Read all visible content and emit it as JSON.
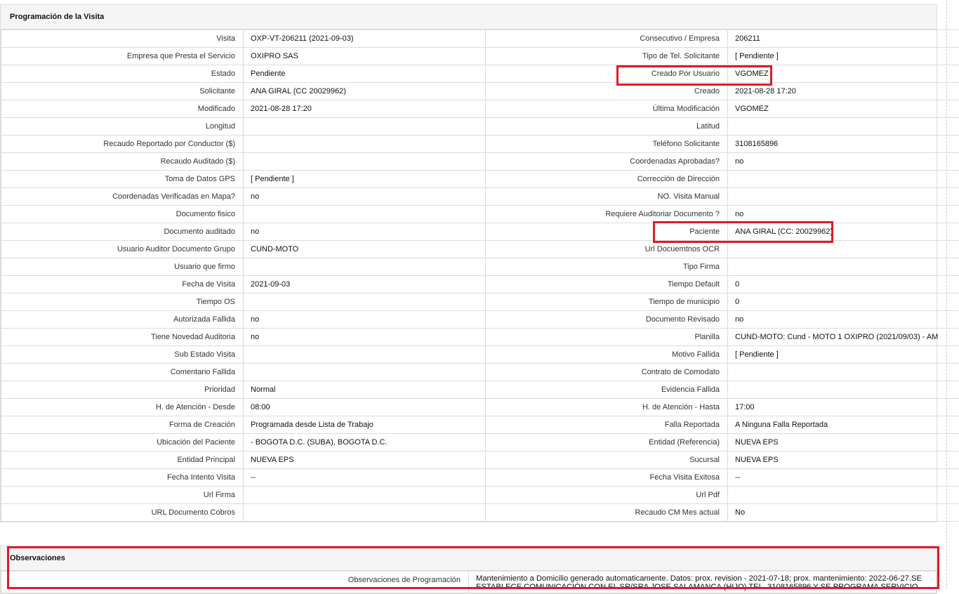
{
  "panel": {
    "title": "Programación de la Visita",
    "rows": [
      [
        {
          "label": "Visita",
          "value": "OXP-VT-206211 (2021-09-03)"
        },
        {
          "label": "Consecutivo / Empresa",
          "value": "206211"
        }
      ],
      [
        {
          "label": "Empresa que Presta el Servicio",
          "value": "OXIPRO SAS"
        },
        {
          "label": "Tipo de Tel. Solicitante",
          "value": "[ Pendiente ]"
        }
      ],
      [
        {
          "label": "Estado",
          "value": "Pendiente"
        },
        {
          "label": "Creado Por Usuario",
          "value": "VGOMEZ"
        }
      ],
      [
        {
          "label": "Solicitante",
          "value": "ANA GIRAL (CC 20029962)"
        },
        {
          "label": "Creado",
          "value": "2021-08-28 17:20"
        }
      ],
      [
        {
          "label": "Modificado",
          "value": "2021-08-28 17:20"
        },
        {
          "label": "Última Modificación",
          "value": " VGOMEZ"
        }
      ],
      [
        {
          "label": "Longitud",
          "value": ""
        },
        {
          "label": "Latitud",
          "value": ""
        }
      ],
      [
        {
          "label": "Recaudo Reportado por Conductor ($)",
          "value": ""
        },
        {
          "label": "Teléfono Solicitante",
          "value": "3108165896"
        }
      ],
      [
        {
          "label": "Recaudo Auditado ($)",
          "value": ""
        },
        {
          "label": "Coordenadas Aprobadas?",
          "value": " no"
        }
      ],
      [
        {
          "label": "Toma de Datos GPS",
          "value": "[ Pendiente ]"
        },
        {
          "label": "Corrección de Dirección",
          "value": ""
        }
      ],
      [
        {
          "label": "Coordenadas Verificadas en Mapa?",
          "value": " no"
        },
        {
          "label": "NO. Visita Manual",
          "value": ""
        }
      ],
      [
        {
          "label": "Documento fisico",
          "value": ""
        },
        {
          "label": "Requiere Auditoriar Documento ?",
          "value": " no"
        }
      ],
      [
        {
          "label": "Documento auditado",
          "value": " no"
        },
        {
          "label": "Paciente",
          "value": "ANA GIRAL (CC: 20029962)"
        }
      ],
      [
        {
          "label": "Usuario Auditor Documento Grupo",
          "value": "CUND-MOTO"
        },
        {
          "label": "Url Docuemtnos OCR",
          "value": ""
        }
      ],
      [
        {
          "label": "Usuario que firmo",
          "value": ""
        },
        {
          "label": "Tipo Firma",
          "value": ""
        }
      ],
      [
        {
          "label": "Fecha de Visita",
          "value": " 2021-09-03"
        },
        {
          "label": "Tiempo Default",
          "value": "0"
        }
      ],
      [
        {
          "label": "Tiempo OS",
          "value": ""
        },
        {
          "label": "Tiempo de municipio",
          "value": "0"
        }
      ],
      [
        {
          "label": "Autorizada Fallida",
          "value": " no"
        },
        {
          "label": "Documento Revisado",
          "value": " no"
        }
      ],
      [
        {
          "label": "Tiene Novedad Auditoria",
          "value": " no"
        },
        {
          "label": "Planilla",
          "value": "CUND-MOTO: Cund - MOTO 1 OXIPRO (2021/09/03) - AM"
        }
      ],
      [
        {
          "label": "Sub Estado Visita",
          "value": ""
        },
        {
          "label": "Motivo Fallida",
          "value": "[ Pendiente ]"
        }
      ],
      [
        {
          "label": "Comentario Fallida",
          "value": ""
        },
        {
          "label": "Contrato de Comodato",
          "value": ""
        }
      ],
      [
        {
          "label": "Prioridad",
          "value": "Normal"
        },
        {
          "label": "Evidencia Fallida",
          "value": ""
        }
      ],
      [
        {
          "label": "H. de Atención - Desde",
          "value": "08:00"
        },
        {
          "label": "H. de Atención - Hasta",
          "value": "17:00"
        }
      ],
      [
        {
          "label": "Forma de Creación",
          "value": "Programada desde Lista de Trabajo"
        },
        {
          "label": "Falla Reportada",
          "value": "A Ninguna Falla Reportada"
        }
      ],
      [
        {
          "label": "Ubicación del Paciente",
          "value": "- BOGOTA D.C. (SUBA), BOGOTA D.C."
        },
        {
          "label": "Entidad (Referencia)",
          "value": "NUEVA EPS"
        }
      ],
      [
        {
          "label": "Entidad Principal",
          "value": "NUEVA EPS"
        },
        {
          "label": "Sucursal",
          "value": "NUEVA EPS"
        }
      ],
      [
        {
          "label": "Fecha Intento Visita",
          "value": " --"
        },
        {
          "label": "Fecha Visita Exitosa",
          "value": " --"
        }
      ],
      [
        {
          "label": "Url Firma",
          "value": ""
        },
        {
          "label": "Url Pdf",
          "value": ""
        }
      ],
      [
        {
          "label": "URL Documento Cobros",
          "value": ""
        },
        {
          "label": "Recaudo CM Mes actual",
          "value": "No"
        }
      ]
    ]
  },
  "observaciones": {
    "title": "Observaciones",
    "label": "Observaciones de Programación",
    "text": " Mantenimiento a Domicilio generado automaticamente. Datos: prox. revision - 2021-07-18; prox. mantenimiento: 2022-06-27.SE ESTABLECE COMUNICACIÓN CON EL SR/SRA JOSE SALAMANCA (HIJO) TEL. 3108165896 Y SE PROGRAMA SERVICIO."
  },
  "colors": {
    "highlight": "#e01b24",
    "border": "#dcdcdc",
    "header_bg": "#f5f5f5"
  }
}
